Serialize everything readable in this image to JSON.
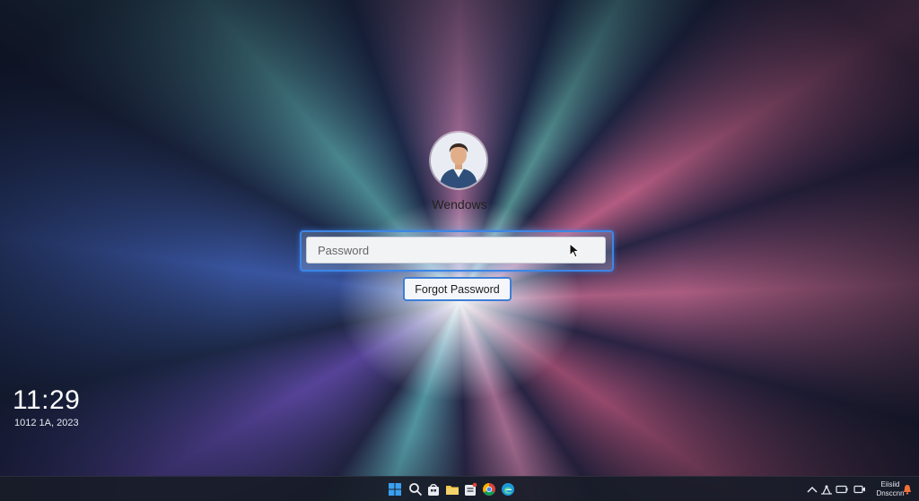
{
  "lock_screen": {
    "user_name": "Wendows",
    "password_placeholder": "Password",
    "forgot_password_label": "Forgot Password"
  },
  "clock": {
    "time": "11:29",
    "date": "1012 1A, 2023"
  },
  "taskbar": {
    "icons": [
      "start-icon",
      "search-icon",
      "store-icon",
      "file-explorer-icon",
      "notes-icon",
      "chrome-icon",
      "edge-icon"
    ],
    "tray_icons": [
      "chevron-up-icon",
      "network-icon",
      "battery-icon",
      "camera-icon",
      "notification-icon"
    ],
    "tray_line1": "Eiisiid",
    "tray_line2": "Dnsccnn"
  },
  "colors": {
    "focus_blue": "#3d86e6",
    "taskbar_bg": "#181c28"
  }
}
